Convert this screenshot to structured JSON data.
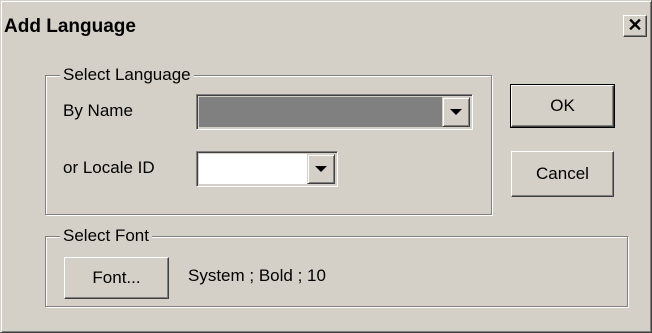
{
  "window": {
    "title": "Add Language",
    "close_glyph": "✕"
  },
  "select_language": {
    "legend": "Select Language",
    "by_name_label": "By Name",
    "by_name_value": "",
    "locale_label": "or Locale ID",
    "locale_value": ""
  },
  "buttons": {
    "ok": "OK",
    "cancel": "Cancel"
  },
  "select_font": {
    "legend": "Select Font",
    "font_button": "Font...",
    "font_value": "System ; Bold ; 10"
  },
  "colors": {
    "face": "#d4d0c8",
    "disabled_field": "#808080",
    "field": "#ffffff"
  },
  "icons": {
    "close": "close-icon",
    "dropdown": "chevron-down-icon"
  }
}
